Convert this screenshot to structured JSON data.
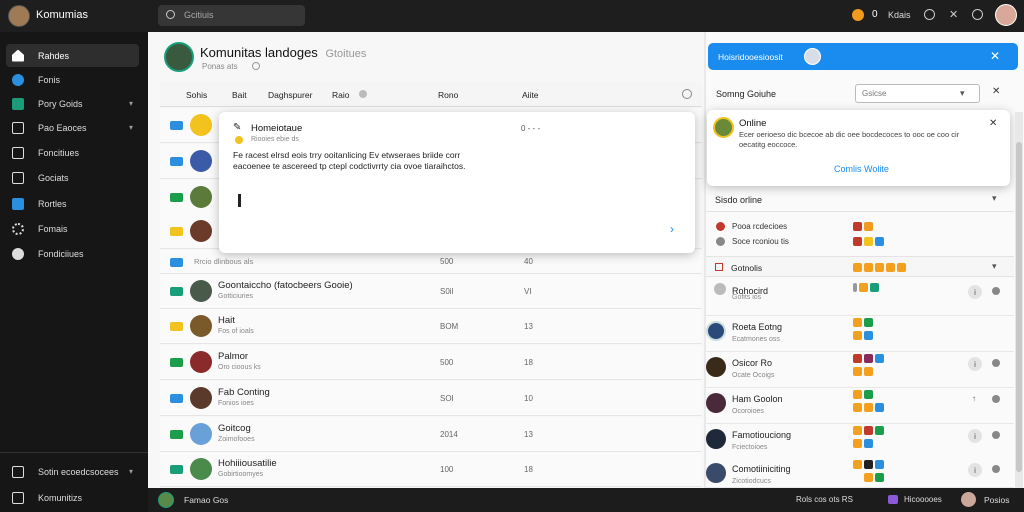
{
  "app": {
    "name": "Komumias"
  },
  "search": {
    "placeholder": "Gcitiuis"
  },
  "topbar": {
    "count": "0",
    "status_label": "Kdais"
  },
  "sidebar": {
    "items": [
      {
        "label": "Rahdes"
      },
      {
        "label": "Fonis"
      },
      {
        "label": "Pory Goids"
      },
      {
        "label": "Pao Eaoces"
      },
      {
        "label": "Foncitiues"
      },
      {
        "label": "Gociats"
      },
      {
        "label": "Rortles"
      },
      {
        "label": "Fomais"
      },
      {
        "label": "Fondiciiues"
      }
    ],
    "footer": [
      {
        "label": "Sotin ecoedcsocees"
      },
      {
        "label": "Komunitizs"
      }
    ]
  },
  "page": {
    "title": "Komunitas landoges",
    "title_suffix": "Gtoitues",
    "subtitle": "Ponas ats"
  },
  "table": {
    "headers": [
      "Sohis",
      "Bait",
      "Daghspurer",
      "Raio",
      "Rono",
      "Aiite"
    ]
  },
  "rows": [
    {
      "title": "",
      "sub": "",
      "c1": "",
      "c2": ""
    },
    {
      "title": "",
      "sub": "",
      "c1": "",
      "c2": ""
    },
    {
      "title": "",
      "sub": "",
      "c1": "",
      "c2": ""
    },
    {
      "title": "",
      "sub": "",
      "c1": "",
      "c2": ""
    },
    {
      "title": "",
      "sub": "Rrcio dlinbous als",
      "c1": "500",
      "c2": "40"
    },
    {
      "title": "Goontaiccho (fatocbeers Gooie)",
      "sub": "Gotticiuries",
      "c1": "S0il",
      "c2": "VI"
    },
    {
      "title": "Hait",
      "sub": "Fos of ioals",
      "c1": "BOM",
      "c2": "13"
    },
    {
      "title": "Palmor",
      "sub": "Oro cioous ks",
      "c1": "500",
      "c2": "18"
    },
    {
      "title": "Fab Conting",
      "sub": "Fonios ioes",
      "c1": "SOI",
      "c2": "10"
    },
    {
      "title": "Goitcog",
      "sub": "Zoimofooes",
      "c1": "2014",
      "c2": "13"
    },
    {
      "title": "Hohiiiousatilie",
      "sub": "Gobirtioomyes",
      "c1": "100",
      "c2": "18"
    }
  ],
  "popup_post": {
    "title": "Homeiotaue",
    "meta": "Riooies ebie ds",
    "time": "0 - - -",
    "body": "Fe racest elrsd eois trry ooitanlicing Ev etwseraes briide corr eacoenee te ascereed tp ctepl codctivrrty cia ovoe tiaraihctos."
  },
  "right": {
    "banner": "Hoisridooesioosit",
    "panel_title": "Somng Goiuhe",
    "filter": "Gsicse",
    "online_popup": {
      "title": "Online",
      "body": "Ecer oerioeso dic bcecoe ab dic oee bocdecoces to ooc oe coo cir oecatitg eoccoce.",
      "action": "Comlis Wolite"
    },
    "section_title": "Sisdo orline",
    "mini_list": [
      {
        "label": "Pooa rcdecioes"
      },
      {
        "label": "Soce rconiou tis"
      }
    ],
    "group_label": "Gotnolis",
    "people": [
      {
        "name": "Rohocird",
        "sub": "Gofits ios"
      },
      {
        "name": "Roeta Eotng",
        "sub": "Ecatmones oss"
      },
      {
        "name": "Osicor Ro",
        "sub": "Ocate Ocoigs"
      },
      {
        "name": "Ham Goolon",
        "sub": "Ocoroioes"
      },
      {
        "name": "Famotiouciong",
        "sub": "Fciectoioes"
      },
      {
        "name": "Comotiiniciting",
        "sub": "Zicotiodcucs"
      }
    ]
  },
  "bottombar": {
    "left_name": "Famao Gos",
    "right_text": "Rols cos ots RS",
    "right_mid": "Hicooooes",
    "right_user": "Posios"
  },
  "colors": {
    "accent": "#1a8cf0",
    "sidebar_bg": "#161616",
    "topbar_bg": "#1e1e1e"
  }
}
